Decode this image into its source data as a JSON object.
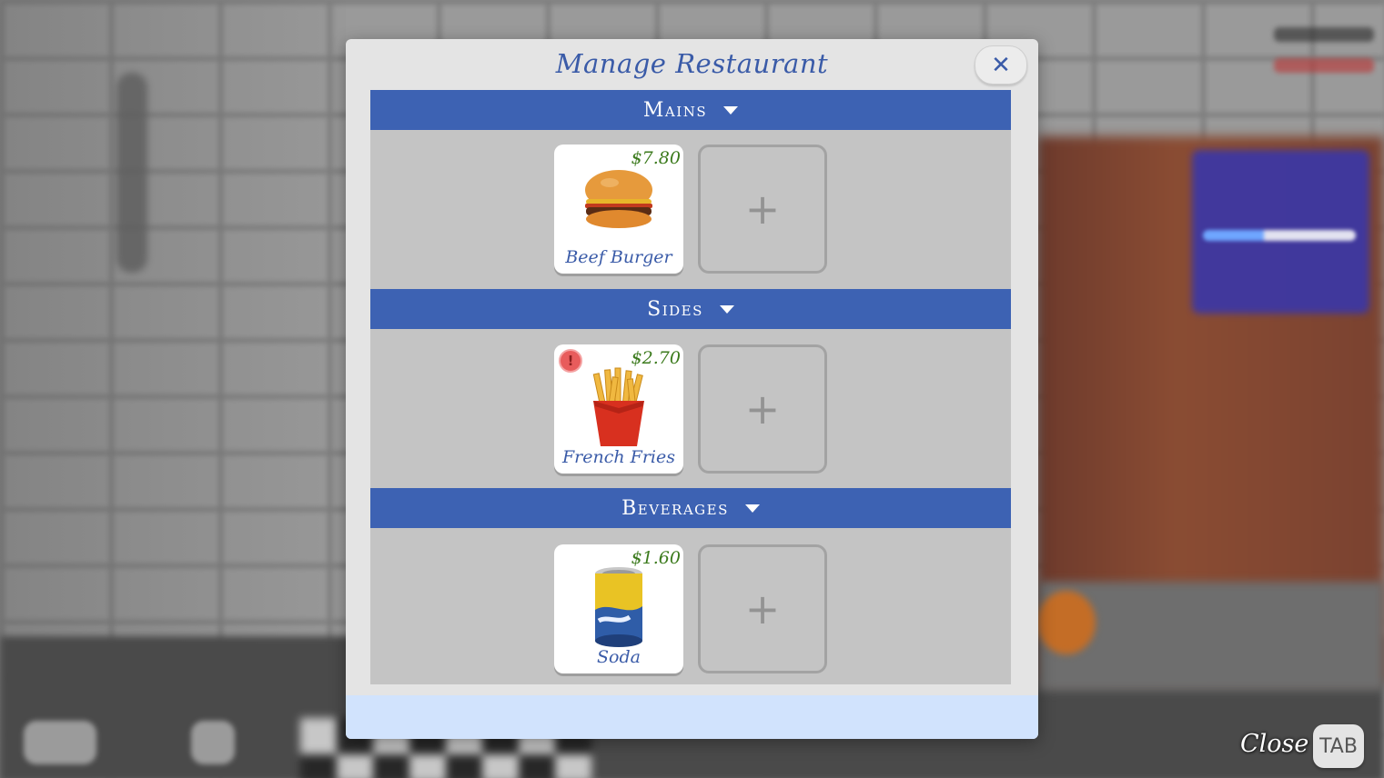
{
  "modal": {
    "title": "Manage Restaurant",
    "close_symbol": "✕"
  },
  "sections": [
    {
      "title": "Mains",
      "items": [
        {
          "name": "Beef Burger",
          "price": "$7.80",
          "icon": "burger-icon",
          "warning": false
        }
      ],
      "add_symbol": "+"
    },
    {
      "title": "Sides",
      "items": [
        {
          "name": "French Fries",
          "price": "$2.70",
          "icon": "fries-icon",
          "warning": true,
          "warning_symbol": "!"
        }
      ],
      "add_symbol": "+"
    },
    {
      "title": "Beverages",
      "items": [
        {
          "name": "Soda",
          "price": "$1.60",
          "icon": "soda-can-icon",
          "warning": false
        }
      ],
      "add_symbol": "+"
    }
  ],
  "hud": {
    "close_label": "Close",
    "close_key": "TAB"
  },
  "colors": {
    "header_blue": "#3d62b3",
    "title_blue": "#3a5ba8",
    "price_green": "#3b7a1c",
    "footer_light_blue": "#d1e3fd",
    "warning_red": "#e85c5c"
  }
}
